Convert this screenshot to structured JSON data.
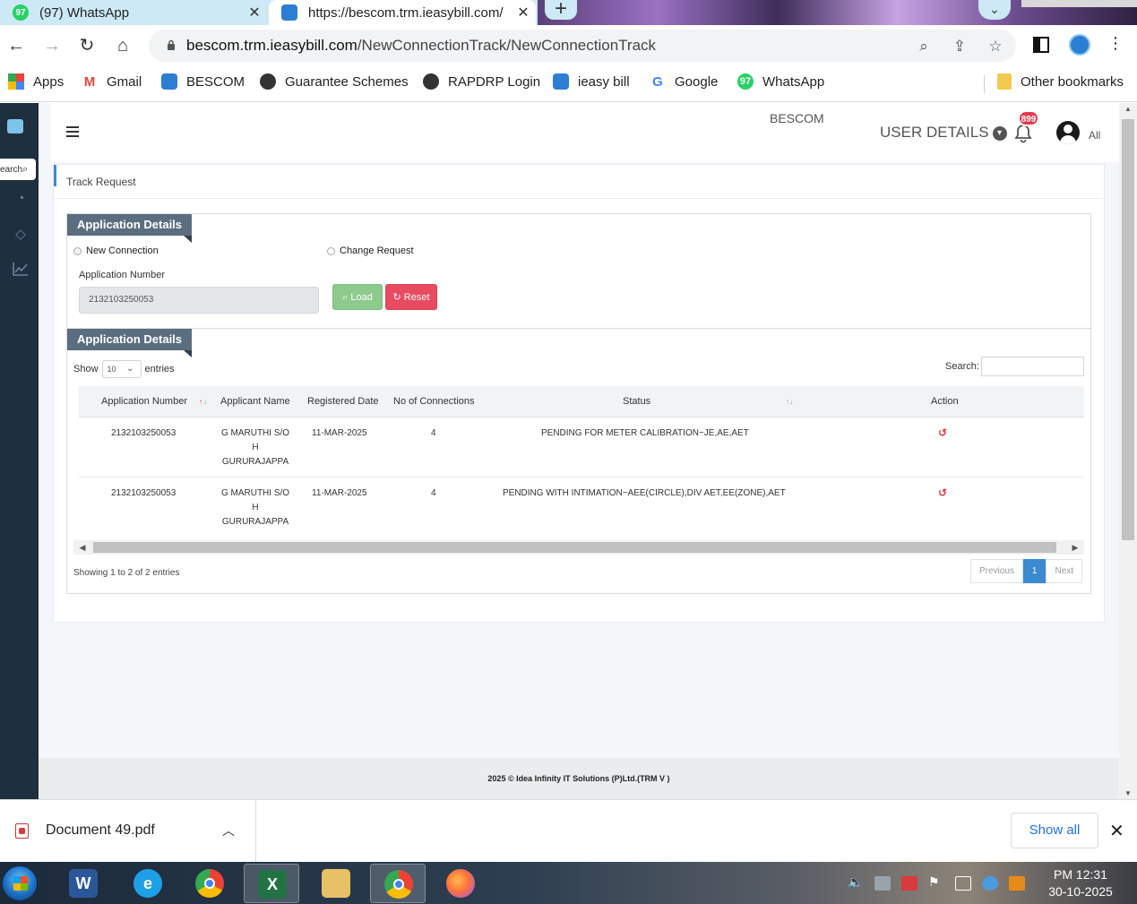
{
  "browser": {
    "tabs": [
      {
        "title": "(97) WhatsApp",
        "badge": "97"
      },
      {
        "title": "https://bescom.trm.ieasybill.com/"
      }
    ],
    "url_host": "bescom.trm.ieasybill.com",
    "url_path": "/NewConnectionTrack/NewConnectionTrack",
    "bookmarks": [
      "Apps",
      "Gmail",
      "BESCOM",
      "Guarantee Schemes",
      "RAPDRP Login",
      "ieasy bill",
      "Google",
      "WhatsApp",
      "Other bookmarks"
    ],
    "whatsapp_badge": "97"
  },
  "sidebar": {
    "search_text": "earch"
  },
  "header": {
    "brand_alt": "BESCOM",
    "user_details": "USER DETAILS",
    "notification_count": "899",
    "user_label": "All"
  },
  "page": {
    "breadcrumb": "Track Request"
  },
  "form": {
    "section_title": "Application Details",
    "radio_new": "New Connection",
    "radio_change": "Change Request",
    "app_number_label": "Application Number",
    "app_number_value": "2132103250053",
    "load_label": "Load",
    "reset_label": "Reset"
  },
  "results": {
    "section_title": "Application Details",
    "show_label": "Show",
    "entries_label": "entries",
    "page_size": "10",
    "search_label": "Search:",
    "columns": [
      "Application Number",
      "Applicant Name",
      "Registered Date",
      "No of Connections",
      "Status",
      "Action"
    ],
    "rows": [
      {
        "app_no": "2132103250053",
        "name_lines": [
          "G MARUTHI S/O",
          "H",
          "GURURAJAPPA"
        ],
        "date": "11-MAR-2025",
        "connections": "4",
        "status": "PENDING FOR METER CALIBRATION~JE,AE,AET"
      },
      {
        "app_no": "2132103250053",
        "name_lines": [
          "G MARUTHI S/O",
          "H",
          "GURURAJAPPA"
        ],
        "date": "11-MAR-2025",
        "connections": "4",
        "status": "PENDING WITH INTIMATION~AEE(CIRCLE),DIV AET,EE(ZONE),AET"
      }
    ],
    "info": "Showing 1 to 2 of 2 entries",
    "pager": {
      "previous": "Previous",
      "current": "1",
      "next": "Next"
    }
  },
  "footer": {
    "text": "2025 © Idea Infinity IT Solutions (P)Ltd.(TRM V )"
  },
  "downloads": {
    "file": "Document 49.pdf",
    "show_all": "Show all"
  },
  "taskbar": {
    "time": "PM 12:31",
    "date": "30-10-2025"
  },
  "colors": {
    "sidebar": "#1e2f3f",
    "ribbon": "#5b6e80",
    "load_button": "#8ccb8c",
    "reset_button": "#e84a5f",
    "accent": "#3a8bd0",
    "badge": "#e8384f"
  }
}
